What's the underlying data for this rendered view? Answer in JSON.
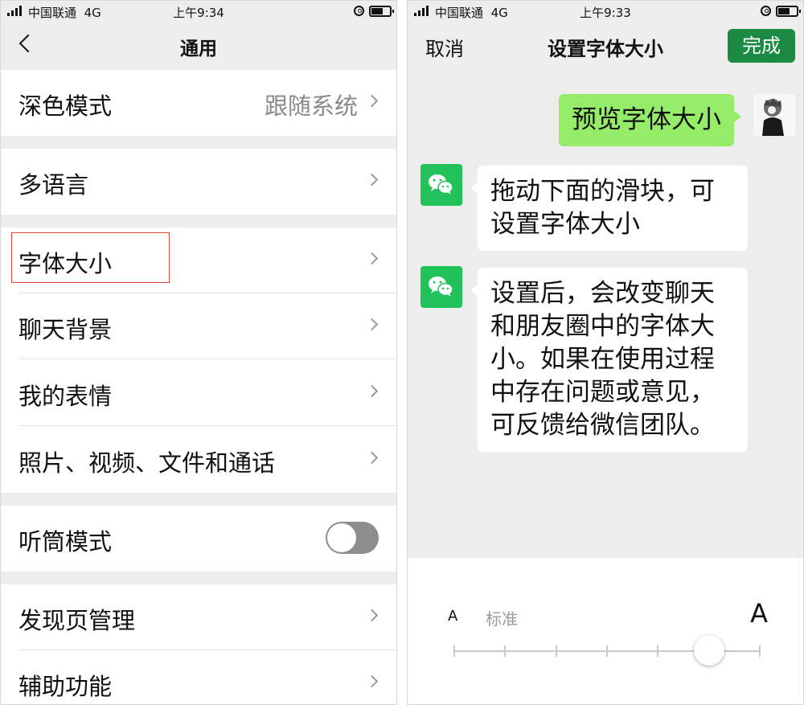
{
  "left": {
    "status": {
      "carrier": "中国联通",
      "network": "4G",
      "time": "上午9:34"
    },
    "nav": {
      "title": "通用"
    },
    "rows": {
      "dark_mode": {
        "label": "深色模式",
        "value": "跟随系统"
      },
      "language": {
        "label": "多语言"
      },
      "font_size": {
        "label": "字体大小"
      },
      "chat_background": {
        "label": "聊天背景"
      },
      "my_stickers": {
        "label": "我的表情"
      },
      "media": {
        "label": "照片、视频、文件和通话"
      },
      "earpiece": {
        "label": "听筒模式",
        "enabled": false
      },
      "discover": {
        "label": "发现页管理"
      },
      "accessibility": {
        "label": "辅助功能"
      }
    }
  },
  "right": {
    "status": {
      "carrier": "中国联通",
      "network": "4G",
      "time": "上午9:33"
    },
    "nav": {
      "cancel": "取消",
      "title": "设置字体大小",
      "done": "完成"
    },
    "messages": {
      "preview": "预览字体大小",
      "hint_1": "拖动下面的滑块，可设置字体大小",
      "hint_2": "设置后，会改变聊天和朋友圈中的字体大小。如果在使用过程中存在问题或意见，可反馈给微信团队。"
    },
    "slider": {
      "small_label": "A",
      "standard_label": "标准",
      "large_label": "A",
      "steps": 7,
      "selected_index": 5
    }
  },
  "colors": {
    "accent_green": "#1c8a43",
    "bubble_green": "#95ec69",
    "wechat_logo": "#21c25a",
    "highlight_red": "#e0473d"
  },
  "icons": [
    "back-arrow",
    "chevron-right",
    "wechat-logo",
    "avatar",
    "signal-bars",
    "orientation-lock",
    "battery"
  ]
}
